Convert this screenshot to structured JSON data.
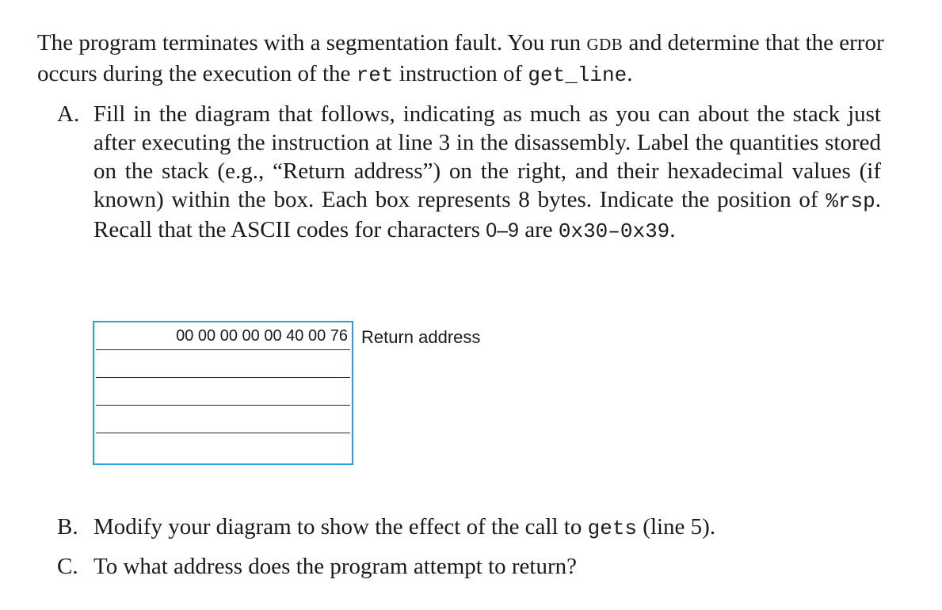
{
  "intro": {
    "t1": "The program terminates with a segmentation fault. You run ",
    "gdb": "GDB",
    "t2": " and determine that the error occurs during the execution of the ",
    "ret": "ret",
    "t3": " instruction of ",
    "fn": "get_line",
    "t4": "."
  },
  "items": {
    "a": {
      "marker": "A.",
      "t1": "Fill in the diagram that follows, indicating as much as you can about the stack just after executing the instruction at line 3 in the disassembly. Label the quantities stored on the stack (e.g., “Return address”) on the right, and their hexadecimal values (if known) within the box. Each box represents 8 bytes. Indicate the position of ",
      "reg": "%rsp",
      "t2": ". Recall that the ASCII codes for characters ",
      "range1": "0–9",
      "t3": " are ",
      "range2": "0x30–0x39",
      "t4": "."
    },
    "b": {
      "marker": "B.",
      "t1": "Modify your diagram to show the effect of the call to ",
      "fn": "gets",
      "t2": " (line 5)."
    },
    "c": {
      "marker": "C.",
      "text": "To what address does the program attempt to return?"
    }
  },
  "diagram": {
    "slots": [
      {
        "value": "00 00 00 00 00 40 00 76",
        "label": "Return address"
      },
      {
        "value": "",
        "label": ""
      },
      {
        "value": "",
        "label": ""
      },
      {
        "value": "",
        "label": ""
      },
      {
        "value": "",
        "label": ""
      }
    ],
    "box_color": "#2ca0dd"
  }
}
